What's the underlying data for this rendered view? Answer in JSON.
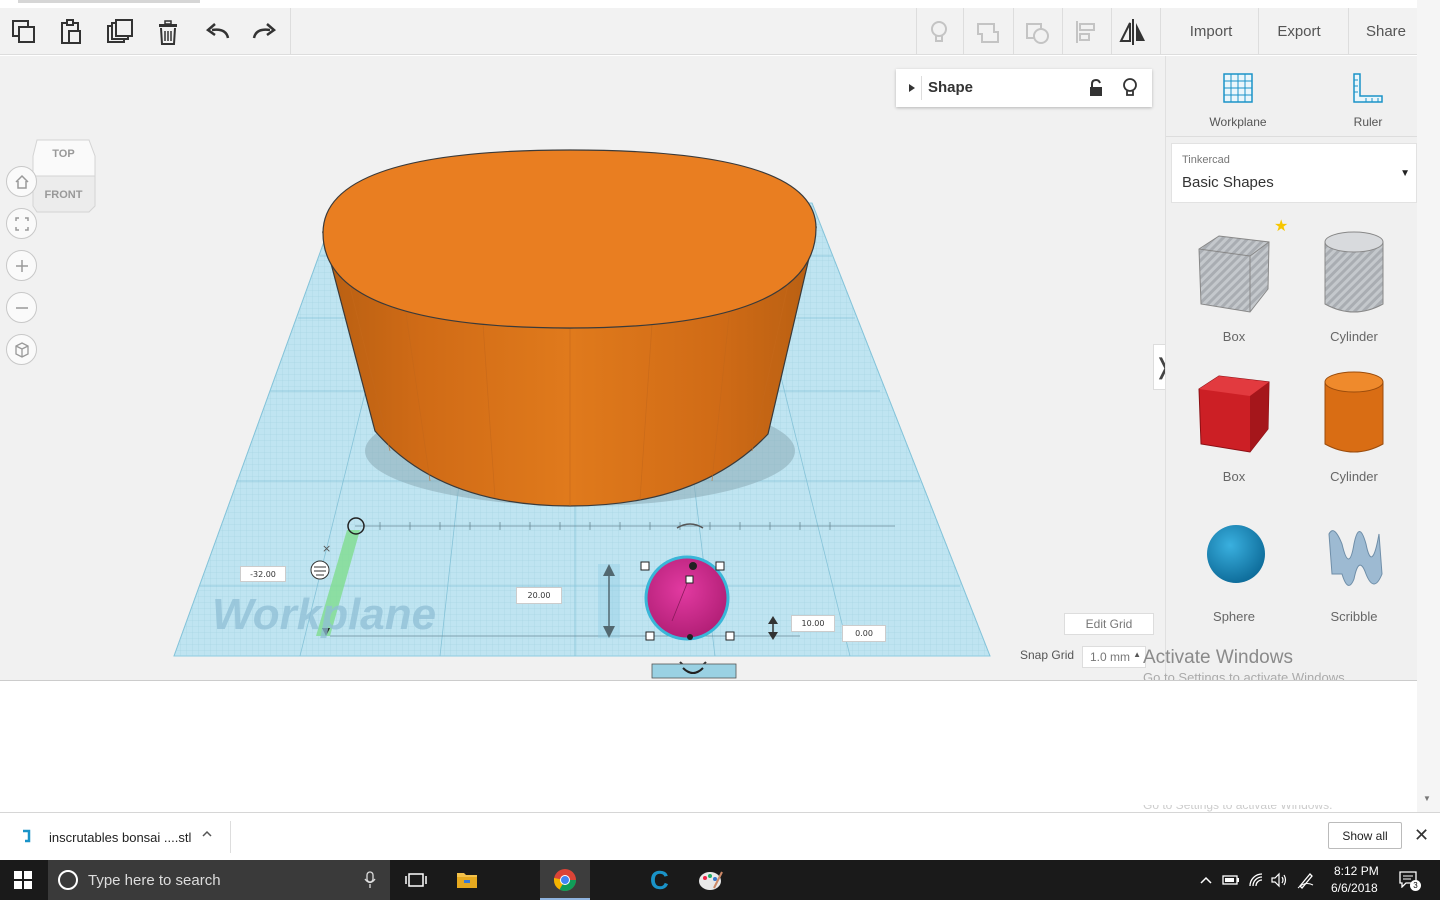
{
  "toolbar": {
    "import_label": "Import",
    "export_label": "Export",
    "share_label": "Share"
  },
  "viewcube": {
    "top_label": "TOP",
    "front_label": "FRONT"
  },
  "inspector": {
    "title": "Shape"
  },
  "workplane": {
    "watermark": "Workplane",
    "dim_x": "-32.00",
    "dim_width": "20.00",
    "dim_height": "10.00",
    "dim_elev": "0.00"
  },
  "panel": {
    "workplane_label": "Workplane",
    "ruler_label": "Ruler",
    "library_category": "Tinkercad",
    "library_name": "Basic Shapes",
    "shapes": [
      {
        "label": "Box"
      },
      {
        "label": "Cylinder"
      },
      {
        "label": "Box"
      },
      {
        "label": "Cylinder"
      },
      {
        "label": "Sphere"
      },
      {
        "label": "Scribble"
      }
    ]
  },
  "grid": {
    "edit_label": "Edit Grid",
    "snap_label": "Snap Grid",
    "snap_value": "1.0 mm"
  },
  "watermark": {
    "line1": "Activate Windows",
    "line2": "Go to Settings to activate Windows.",
    "line3": "Go to Settings to activate Windows."
  },
  "download": {
    "filename": "inscrutables bonsai ....stl",
    "show_all_label": "Show all"
  },
  "taskbar": {
    "search_placeholder": "Type here to search",
    "time": "8:12 PM",
    "date": "6/6/2018",
    "notification_count": "3"
  },
  "colors": {
    "orange": "#e97e21",
    "pink": "#d6278f",
    "red": "#cc1f25",
    "blue": "#1a93c8",
    "grid": "#a6d9ea"
  }
}
